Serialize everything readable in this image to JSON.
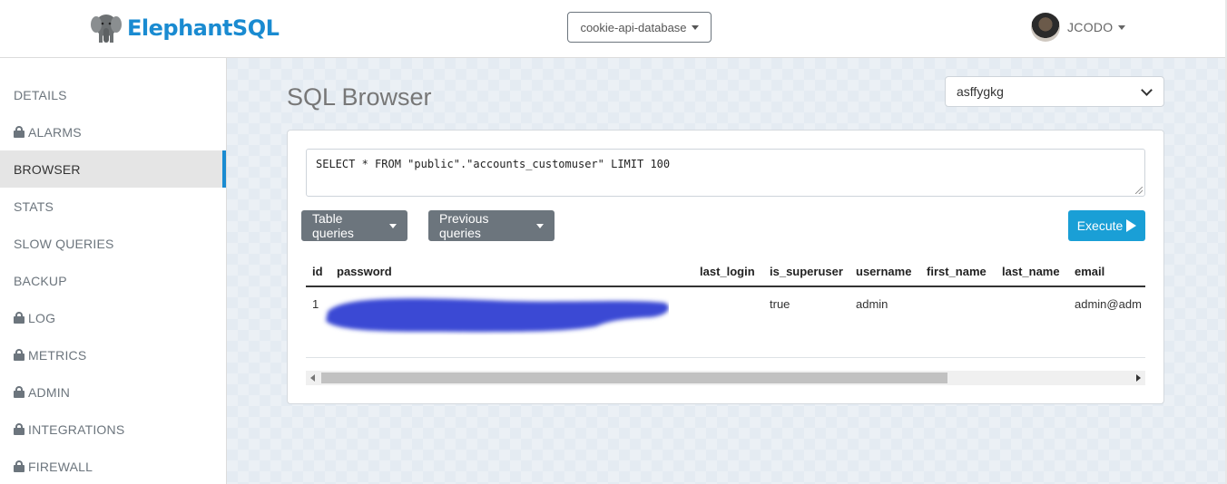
{
  "app": {
    "name": "ElephantSQL"
  },
  "header": {
    "database_selector": "cookie-api-database",
    "user_name": "JCODO"
  },
  "sidebar": {
    "items": [
      {
        "label": "DETAILS",
        "locked": false,
        "active": false
      },
      {
        "label": "ALARMS",
        "locked": true,
        "active": false
      },
      {
        "label": "BROWSER",
        "locked": false,
        "active": true
      },
      {
        "label": "STATS",
        "locked": false,
        "active": false
      },
      {
        "label": "SLOW QUERIES",
        "locked": false,
        "active": false
      },
      {
        "label": "BACKUP",
        "locked": false,
        "active": false
      },
      {
        "label": "LOG",
        "locked": true,
        "active": false
      },
      {
        "label": "METRICS",
        "locked": true,
        "active": false
      },
      {
        "label": "ADMIN",
        "locked": true,
        "active": false
      },
      {
        "label": "INTEGRATIONS",
        "locked": true,
        "active": false
      },
      {
        "label": "FIREWALL",
        "locked": true,
        "active": false
      }
    ]
  },
  "main": {
    "title": "SQL Browser",
    "connection_select": "asffygkg",
    "query": "SELECT * FROM \"public\".\"accounts_customuser\" LIMIT 100",
    "buttons": {
      "table_queries": "Table queries",
      "previous_queries": "Previous queries",
      "execute": "Execute"
    },
    "table": {
      "columns": [
        "id",
        "password",
        "last_login",
        "is_superuser",
        "username",
        "first_name",
        "last_name",
        "email"
      ],
      "rows": [
        [
          "1",
          "",
          "",
          "true",
          "admin",
          "",
          "",
          "admin@adm"
        ]
      ]
    }
  },
  "colors": {
    "brand": "#1a8bd1",
    "execute": "#1a9fd6",
    "secondary": "#6c757d",
    "redaction": "#3b48d4"
  }
}
